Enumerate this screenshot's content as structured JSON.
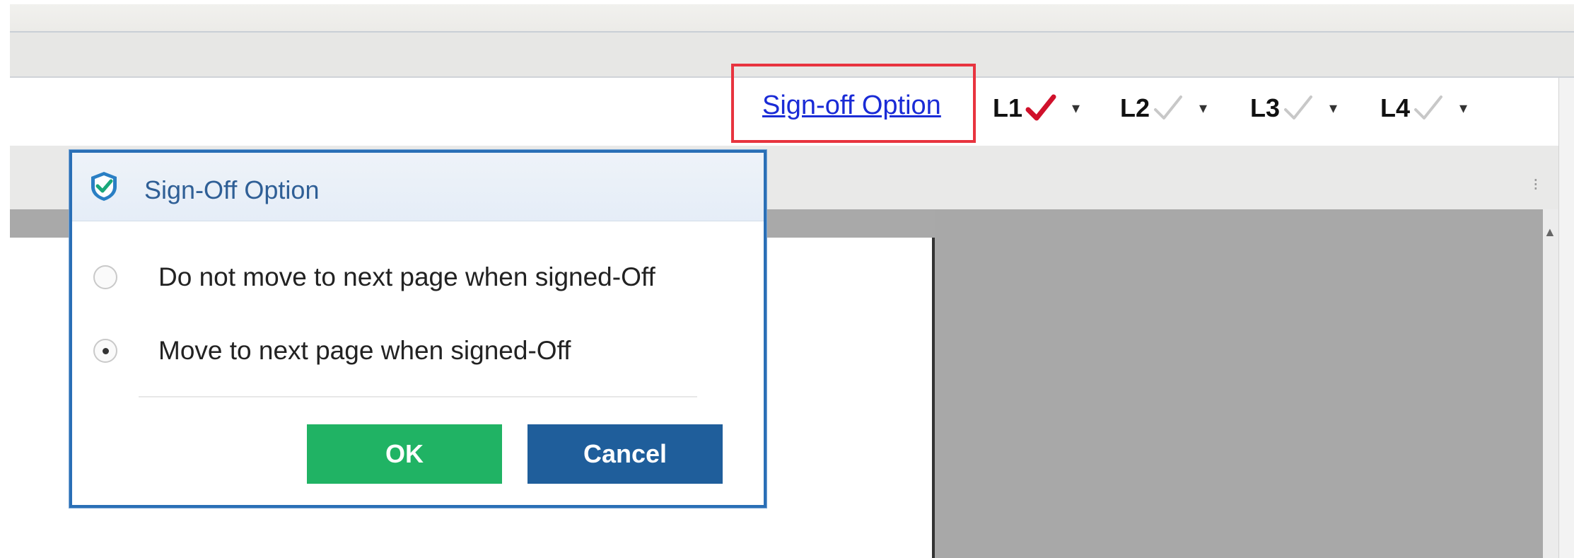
{
  "signoff_bar": {
    "link_label": "Sign-off Option",
    "levels": [
      {
        "label": "L1",
        "signed": true,
        "check_color": "#d0112b",
        "icon": "check-icon"
      },
      {
        "label": "L2",
        "signed": false,
        "check_color": "#c8c8c8",
        "icon": "check-icon"
      },
      {
        "label": "L3",
        "signed": false,
        "check_color": "#c8c8c8",
        "icon": "check-icon"
      },
      {
        "label": "L4",
        "signed": false,
        "check_color": "#c8c8c8",
        "icon": "check-icon"
      }
    ],
    "caret": "▾"
  },
  "dialog": {
    "title": "Sign-Off Option",
    "options": [
      {
        "label": "Do not move to next page when signed-Off",
        "selected": false
      },
      {
        "label": "Move to next page when signed-Off",
        "selected": true
      }
    ],
    "ok_label": "OK",
    "cancel_label": "Cancel"
  },
  "colors": {
    "highlight": "#e8343f",
    "link": "#1a2bd6",
    "ok_button": "#20b364",
    "cancel_button": "#1f5e9b",
    "dialog_border": "#2a6fb6"
  }
}
